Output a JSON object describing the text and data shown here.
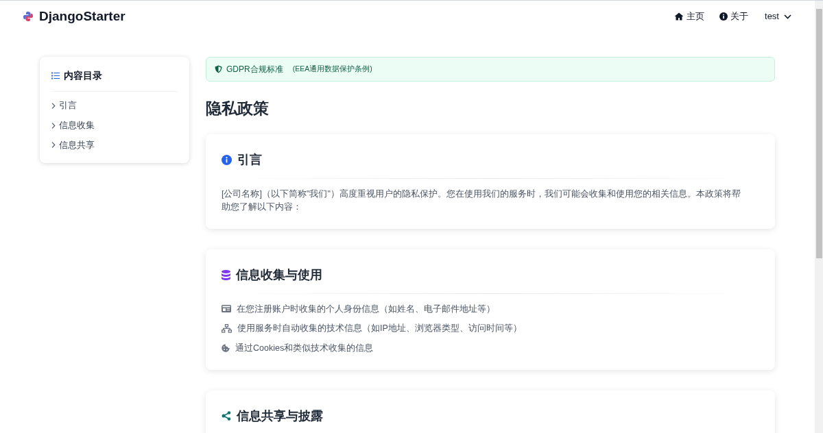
{
  "navbar": {
    "brand": "DjangoStarter",
    "links": [
      {
        "kind": "home",
        "label": "主页"
      },
      {
        "kind": "about",
        "label": "关于"
      }
    ],
    "user_menu": "test"
  },
  "toc": {
    "title": "内容目录",
    "items": [
      "引言",
      "信息收集",
      "信息共享"
    ]
  },
  "alert": {
    "title": "GDPR合规标准",
    "note": "(EEA通用数据保护条例)"
  },
  "page_title": "隐私政策",
  "sections": [
    {
      "kind": "info",
      "title": "引言",
      "paragraph": "[公司名称]（以下简称\"我们\"）高度重视用户的隐私保护。您在使用我们的服务时，我们可能会收集和使用您的相关信息。本政策将帮助您了解以下内容："
    },
    {
      "kind": "database",
      "title": "信息收集与使用",
      "items": [
        {
          "kind": "id-card",
          "text": "在您注册账户时收集的个人身份信息（如姓名、电子邮件地址等）"
        },
        {
          "kind": "network",
          "text": "使用服务时自动收集的技术信息（如IP地址、浏览器类型、访问时间等）"
        },
        {
          "kind": "cookie",
          "text": "通过Cookies和类似技术收集的信息"
        }
      ]
    },
    {
      "kind": "share",
      "title": "信息共享与披露"
    }
  ]
}
